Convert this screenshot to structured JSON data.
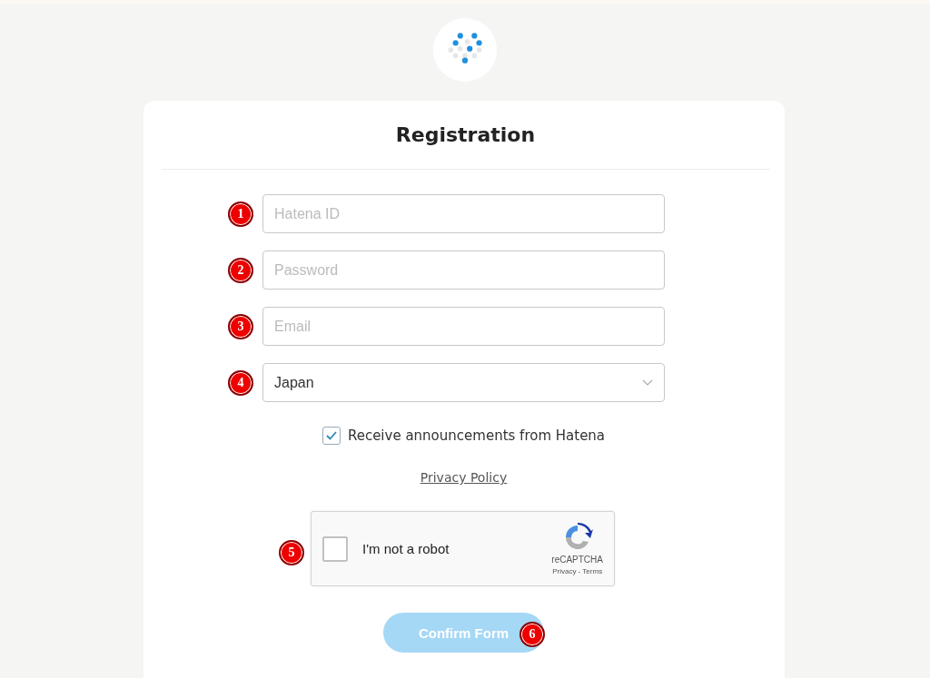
{
  "title": "Registration",
  "fields": [
    {
      "kind": "input",
      "placeholder": "Hatena ID",
      "marker": "1"
    },
    {
      "kind": "input",
      "placeholder": "Password",
      "marker": "2"
    },
    {
      "kind": "input",
      "placeholder": "Email",
      "marker": "3"
    },
    {
      "kind": "select",
      "value": "Japan",
      "marker": "4"
    }
  ],
  "announcements": {
    "label": "Receive announcements from Hatena",
    "checked": true
  },
  "privacy_link": "Privacy Policy",
  "captcha": {
    "label": "I'm not a robot",
    "checked": false,
    "brand": "reCAPTCHA",
    "links": "Privacy - Terms",
    "marker": "5"
  },
  "confirm_button": {
    "label": "Confirm Form",
    "disabled": true,
    "marker": "6"
  }
}
